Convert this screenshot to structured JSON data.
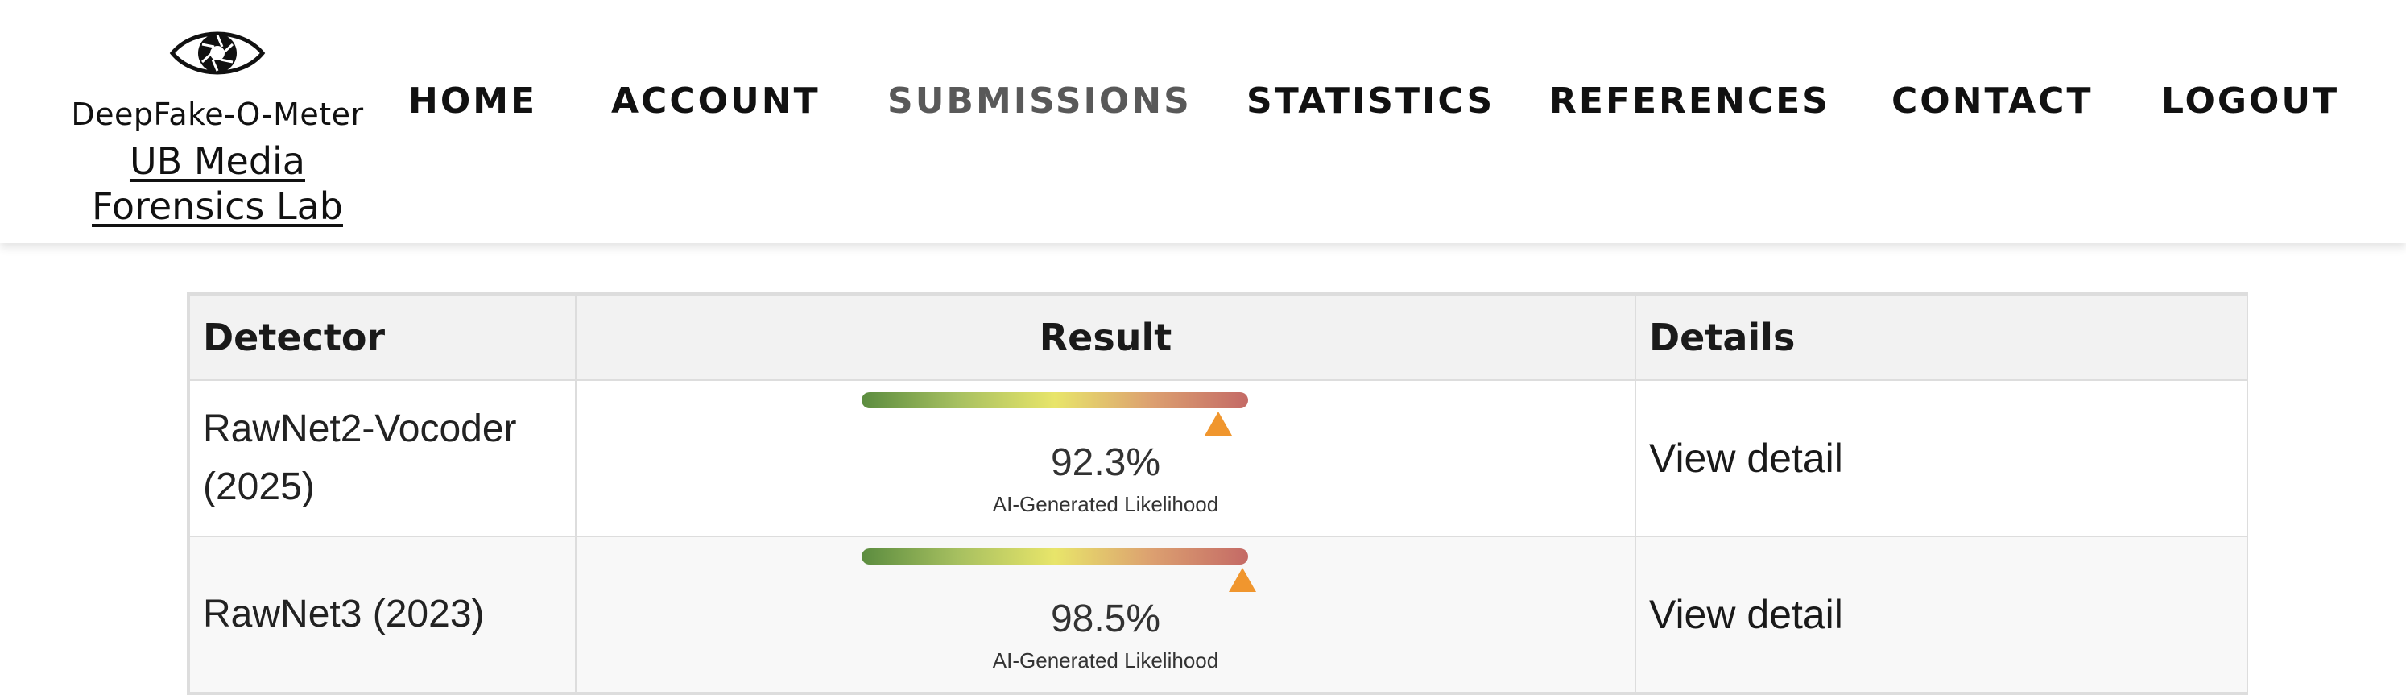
{
  "brand": {
    "logo_icon": "eye-aperture-icon",
    "name": "DeepFake-O-Meter",
    "lab": "UB Media Forensics Lab"
  },
  "nav": {
    "items": [
      "HOME",
      "ACCOUNT",
      "SUBMISSIONS",
      "STATISTICS",
      "REFERENCES",
      "CONTACT",
      "LOGOUT"
    ],
    "active": "SUBMISSIONS"
  },
  "table": {
    "headers": [
      "Detector",
      "Result",
      "Details"
    ],
    "rows": [
      {
        "detector": "RawNet2-Vocoder (2025)",
        "likelihood": 0.923,
        "percent": "92.3%",
        "caption": "AI-Generated Likelihood",
        "details": "View detail"
      },
      {
        "detector": "RawNet3 (2023)",
        "likelihood": 0.985,
        "percent": "98.5%",
        "caption": "AI-Generated Likelihood",
        "details": "View detail"
      }
    ]
  },
  "colors": {
    "marker": "#f0962e",
    "gradient_start": "#5b8c3f",
    "gradient_mid": "#e8e56a",
    "gradient_end": "#c46a66",
    "nav_active": "#595959"
  }
}
